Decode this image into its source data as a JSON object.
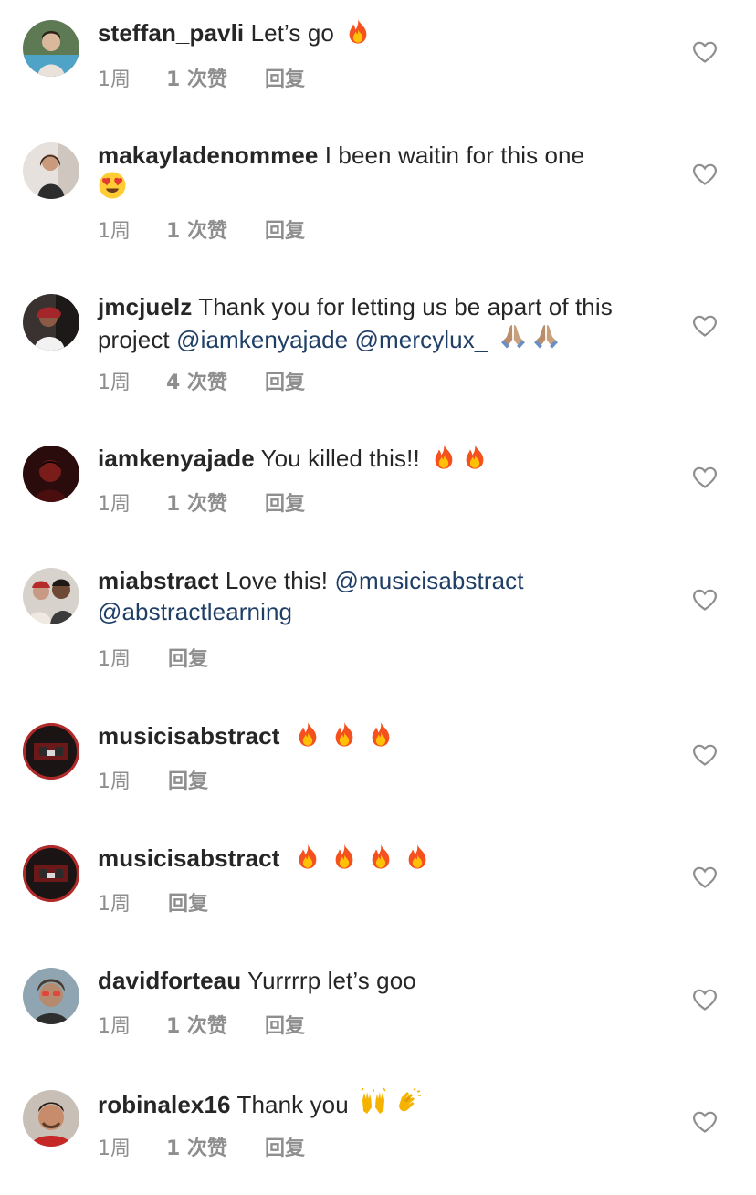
{
  "comments": [
    {
      "username": "steffan_pavli",
      "text": "Let’s go",
      "emojis": [
        "fire"
      ],
      "time": "1周",
      "likes": "1 次赞",
      "reply": "回复"
    },
    {
      "username": "makayladenommee",
      "text": "I been waitin for this one",
      "emojis": [
        "heart-eyes"
      ],
      "time": "1周",
      "likes": "1 次赞",
      "reply": "回复"
    },
    {
      "username": "jmcjuelz",
      "text": "Thank you for letting us be apart of this project",
      "mention1": "@iamkenyajade",
      "mention2": "@mercylux_",
      "emojis": [
        "pray",
        "pray"
      ],
      "time": "1周",
      "likes": "4 次赞",
      "reply": "回复"
    },
    {
      "username": "iamkenyajade",
      "text": "You killed this!!",
      "emojis": [
        "fire",
        "fire"
      ],
      "time": "1周",
      "likes": "1 次赞",
      "reply": "回复"
    },
    {
      "username": "miabstract",
      "text": "Love this!",
      "mention1": "@musicisabstract",
      "mention2": "@abstractlearning",
      "emojis": [],
      "time": "1周",
      "reply": "回复"
    },
    {
      "username": "musicisabstract",
      "text": "",
      "emojis": [
        "fire",
        "fire",
        "fire"
      ],
      "time": "1周",
      "reply": "回复"
    },
    {
      "username": "musicisabstract",
      "text": "",
      "emojis": [
        "fire",
        "fire",
        "fire",
        "fire"
      ],
      "time": "1周",
      "reply": "回复"
    },
    {
      "username": "davidforteau",
      "text": "Yurrrrp let’s goo",
      "emojis": [],
      "time": "1周",
      "likes": "1 次赞",
      "reply": "回复"
    },
    {
      "username": "robinalex16",
      "text": "Thank you",
      "emojis": [
        "raised-hands",
        "clapping-hands"
      ],
      "time": "1周",
      "likes": "1 次赞",
      "reply": "回复"
    }
  ],
  "icons": {
    "like": "heart-outline-icon"
  },
  "colors": {
    "text": "#262626",
    "meta": "#8e8e8e",
    "mention": "#1f3f67",
    "fire": "#f4511e"
  }
}
